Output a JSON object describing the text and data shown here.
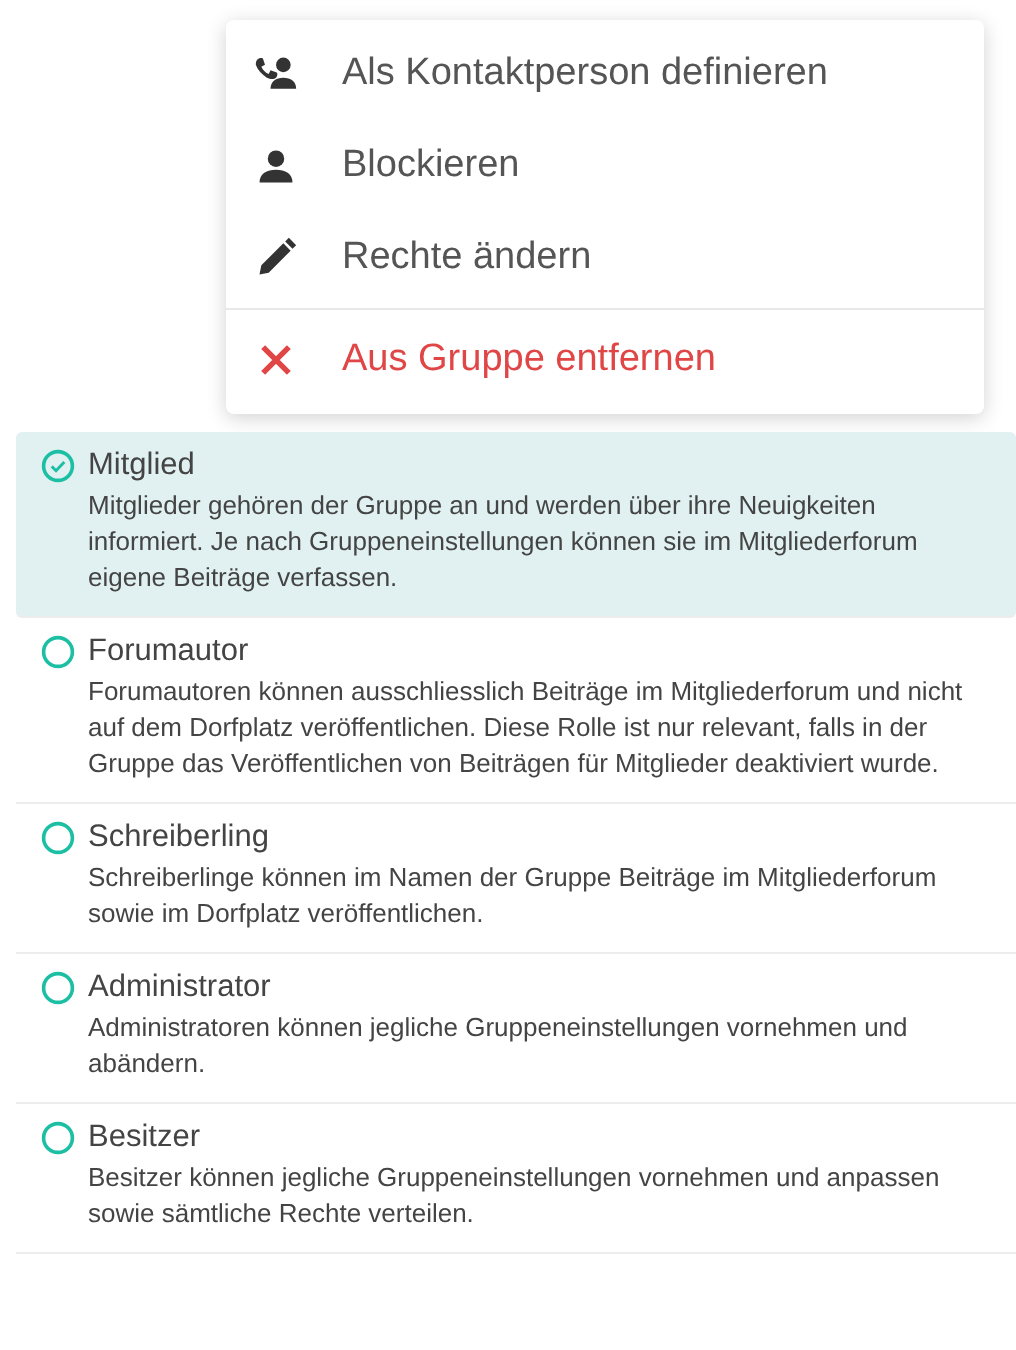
{
  "menu": {
    "items": [
      {
        "kind": "contact",
        "label": "Als Kontaktperson definieren",
        "danger": false
      },
      {
        "kind": "block",
        "label": "Blockieren",
        "danger": false
      },
      {
        "kind": "edit",
        "label": "Rechte ändern",
        "danger": false
      },
      {
        "kind": "remove",
        "label": "Aus Gruppe entfernen",
        "danger": true
      }
    ]
  },
  "roles": [
    {
      "name": "Mitglied",
      "selected": true,
      "description": "Mitglieder gehören der Gruppe an und werden über ihre Neuigkeiten informiert. Je nach Gruppeneinstellungen können sie im Mitgliederforum eigene Beiträge verfassen."
    },
    {
      "name": "Forumautor",
      "selected": false,
      "description": "Forumautoren können ausschliesslich Beiträge im Mitgliederforum und nicht auf dem Dorfplatz veröffentlichen. Diese Rolle ist nur relevant, falls in der Gruppe das Veröffentlichen von Beiträgen für Mitglieder deaktiviert wurde."
    },
    {
      "name": "Schreiberling",
      "selected": false,
      "description": "Schreiberlinge können im Namen der Gruppe Beiträge im Mitgliederforum sowie im Dorfplatz veröffentlichen."
    },
    {
      "name": "Administrator",
      "selected": false,
      "description": "Administratoren können jegliche Gruppeneinstellungen vornehmen und abändern."
    },
    {
      "name": "Besitzer",
      "selected": false,
      "description": "Besitzer können jegliche Gruppeneinstellungen vornehmen und anpassen sowie sämtliche Rechte verteilen."
    }
  ]
}
